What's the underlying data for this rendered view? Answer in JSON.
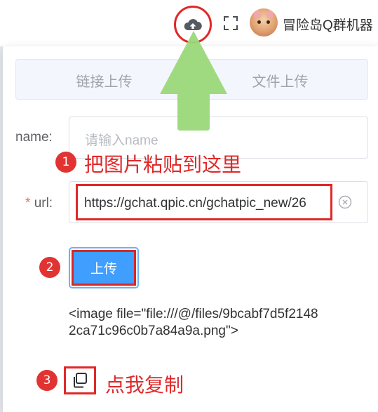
{
  "header": {
    "upload_icon": "cloud-upload-icon",
    "fullscreen_icon": "fullscreen-icon",
    "username": "冒险岛Q群机器"
  },
  "tabs": [
    {
      "label": "链接上传",
      "active": true
    },
    {
      "label": "文件上传",
      "active": false
    }
  ],
  "form": {
    "name_label": "name:",
    "name_placeholder": "请输入name",
    "url_required_mark": "*",
    "url_label": "url:",
    "url_value": "https://gchat.qpic.cn/gchatpic_new/26",
    "submit_label": "上传"
  },
  "result": {
    "code": "<image file=\"file:///@/files/9bcabf7d5f21482ca71c96c0b7a84a9a.png\">"
  },
  "annotations": {
    "step1_num": "1",
    "step1_text": "把图片粘贴到这里",
    "step2_num": "2",
    "step3_num": "3",
    "step3_text": "点我复制"
  },
  "colors": {
    "primary": "#409eff",
    "annotation_red": "#e02828",
    "arrow_green": "#9ad87a"
  }
}
